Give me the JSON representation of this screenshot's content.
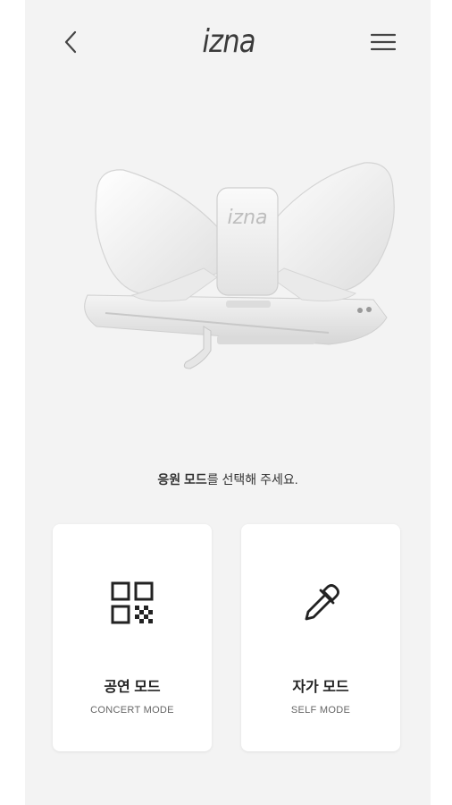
{
  "header": {
    "logo_text": "izna",
    "back_icon": "chevron-left-icon",
    "menu_icon": "hamburger-menu-icon"
  },
  "product": {
    "emblem_text": "izna"
  },
  "prompt": {
    "bold_part": "응원 모드",
    "rest": "를 선택해 주세요."
  },
  "modes": [
    {
      "title": "공연 모드",
      "subtitle": "CONCERT MODE",
      "icon": "qr-code-icon"
    },
    {
      "title": "자가 모드",
      "subtitle": "SELF MODE",
      "icon": "eyedropper-icon"
    }
  ],
  "colors": {
    "screen_bg": "#f3f3f3",
    "card_bg": "#ffffff",
    "text": "#222222"
  }
}
